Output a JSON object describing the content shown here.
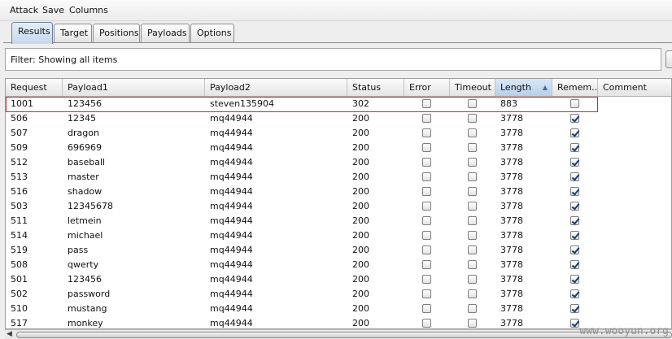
{
  "menu": [
    "Attack",
    "Save",
    "Columns"
  ],
  "tabs": [
    {
      "label": "Results",
      "active": true
    },
    {
      "label": "Target",
      "active": false
    },
    {
      "label": "Positions",
      "active": false
    },
    {
      "label": "Payloads",
      "active": false
    },
    {
      "label": "Options",
      "active": false
    }
  ],
  "filter": {
    "text": "Filter:  Showing all items"
  },
  "table": {
    "columns": [
      "Request",
      "Payload1",
      "Payload2",
      "Status",
      "Error",
      "Timeout",
      "Length",
      "Remem...",
      "Comment"
    ],
    "sorted_column": "Length",
    "sort_direction": "ascending",
    "highlight_color": "#c03030",
    "rows": [
      {
        "request": "1001",
        "payload1": "123456",
        "payload2": "steven135904",
        "status": "302",
        "error": false,
        "timeout": false,
        "length": "883",
        "remember": false,
        "comment": "",
        "highlighted": true
      },
      {
        "request": "506",
        "payload1": "12345",
        "payload2": "mq44944",
        "status": "200",
        "error": false,
        "timeout": false,
        "length": "3778",
        "remember": true,
        "comment": ""
      },
      {
        "request": "507",
        "payload1": "dragon",
        "payload2": "mq44944",
        "status": "200",
        "error": false,
        "timeout": false,
        "length": "3778",
        "remember": true,
        "comment": ""
      },
      {
        "request": "509",
        "payload1": "696969",
        "payload2": "mq44944",
        "status": "200",
        "error": false,
        "timeout": false,
        "length": "3778",
        "remember": true,
        "comment": ""
      },
      {
        "request": "512",
        "payload1": "baseball",
        "payload2": "mq44944",
        "status": "200",
        "error": false,
        "timeout": false,
        "length": "3778",
        "remember": true,
        "comment": ""
      },
      {
        "request": "513",
        "payload1": "master",
        "payload2": "mq44944",
        "status": "200",
        "error": false,
        "timeout": false,
        "length": "3778",
        "remember": true,
        "comment": ""
      },
      {
        "request": "516",
        "payload1": "shadow",
        "payload2": "mq44944",
        "status": "200",
        "error": false,
        "timeout": false,
        "length": "3778",
        "remember": true,
        "comment": ""
      },
      {
        "request": "503",
        "payload1": "12345678",
        "payload2": "mq44944",
        "status": "200",
        "error": false,
        "timeout": false,
        "length": "3778",
        "remember": true,
        "comment": ""
      },
      {
        "request": "511",
        "payload1": "letmein",
        "payload2": "mq44944",
        "status": "200",
        "error": false,
        "timeout": false,
        "length": "3778",
        "remember": true,
        "comment": ""
      },
      {
        "request": "514",
        "payload1": "michael",
        "payload2": "mq44944",
        "status": "200",
        "error": false,
        "timeout": false,
        "length": "3778",
        "remember": true,
        "comment": ""
      },
      {
        "request": "519",
        "payload1": "pass",
        "payload2": "mq44944",
        "status": "200",
        "error": false,
        "timeout": false,
        "length": "3778",
        "remember": true,
        "comment": ""
      },
      {
        "request": "508",
        "payload1": "qwerty",
        "payload2": "mq44944",
        "status": "200",
        "error": false,
        "timeout": false,
        "length": "3778",
        "remember": true,
        "comment": ""
      },
      {
        "request": "501",
        "payload1": "123456",
        "payload2": "mq44944",
        "status": "200",
        "error": false,
        "timeout": false,
        "length": "3778",
        "remember": true,
        "comment": ""
      },
      {
        "request": "502",
        "payload1": "password",
        "payload2": "mq44944",
        "status": "200",
        "error": false,
        "timeout": false,
        "length": "3778",
        "remember": true,
        "comment": ""
      },
      {
        "request": "510",
        "payload1": "mustang",
        "payload2": "mq44944",
        "status": "200",
        "error": false,
        "timeout": false,
        "length": "3778",
        "remember": true,
        "comment": ""
      },
      {
        "request": "517",
        "payload1": "monkey",
        "payload2": "mq44944",
        "status": "200",
        "error": false,
        "timeout": false,
        "length": "3778",
        "remember": true,
        "comment": ""
      }
    ]
  },
  "watermark": "www.wooyun.org"
}
